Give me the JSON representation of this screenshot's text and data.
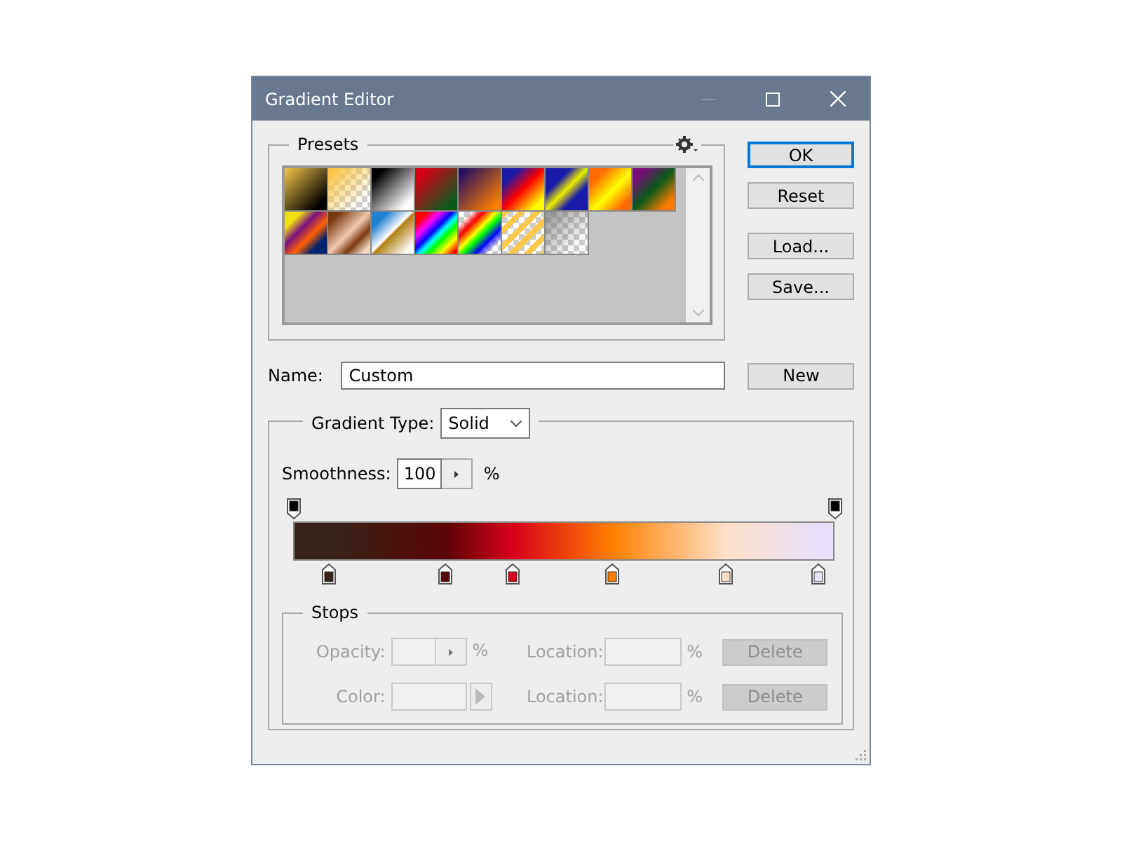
{
  "window": {
    "title": "Gradient Editor"
  },
  "presets": {
    "label": "Presets"
  },
  "buttons": [
    {
      "label": "OK",
      "selected": true
    },
    {
      "label": "Reset",
      "selected": false
    },
    {
      "label": "Load...",
      "selected": false
    },
    {
      "label": "Save...",
      "selected": false
    }
  ],
  "name": {
    "label": "Name:",
    "value": "Custom",
    "button": "New"
  },
  "gradient": {
    "type_label": "Gradient Type:",
    "type_value": "Solid",
    "smoothness_label": "Smoothness:",
    "smoothness_value": "100",
    "smoothness_unit": "%",
    "opacity_stops": [
      {
        "color": "#000000",
        "level": 0
      },
      {
        "color": "#000000",
        "level": 1
      }
    ],
    "color_stops": [
      {
        "color": "#36241a",
        "level": 0.065
      },
      {
        "color": "#5a0505",
        "level": 0.28
      },
      {
        "color": "#d8001b",
        "level": 0.405
      },
      {
        "color": "#ff7f00",
        "level": 0.59
      },
      {
        "color": "#fde0c8",
        "level": 0.8
      },
      {
        "color": "#e8e0f8",
        "level": 0.97
      }
    ]
  },
  "stops": {
    "label": "Stops",
    "disabled": true,
    "rows": [
      {
        "kind": "opacity",
        "label": "Opacity:",
        "unit": "%",
        "location_label": "Location:",
        "location_unit": "%",
        "button": "Delete"
      },
      {
        "kind": "color",
        "label": "Color:",
        "location_label": "Location:",
        "location_unit": "%",
        "button": "Delete"
      }
    ]
  }
}
